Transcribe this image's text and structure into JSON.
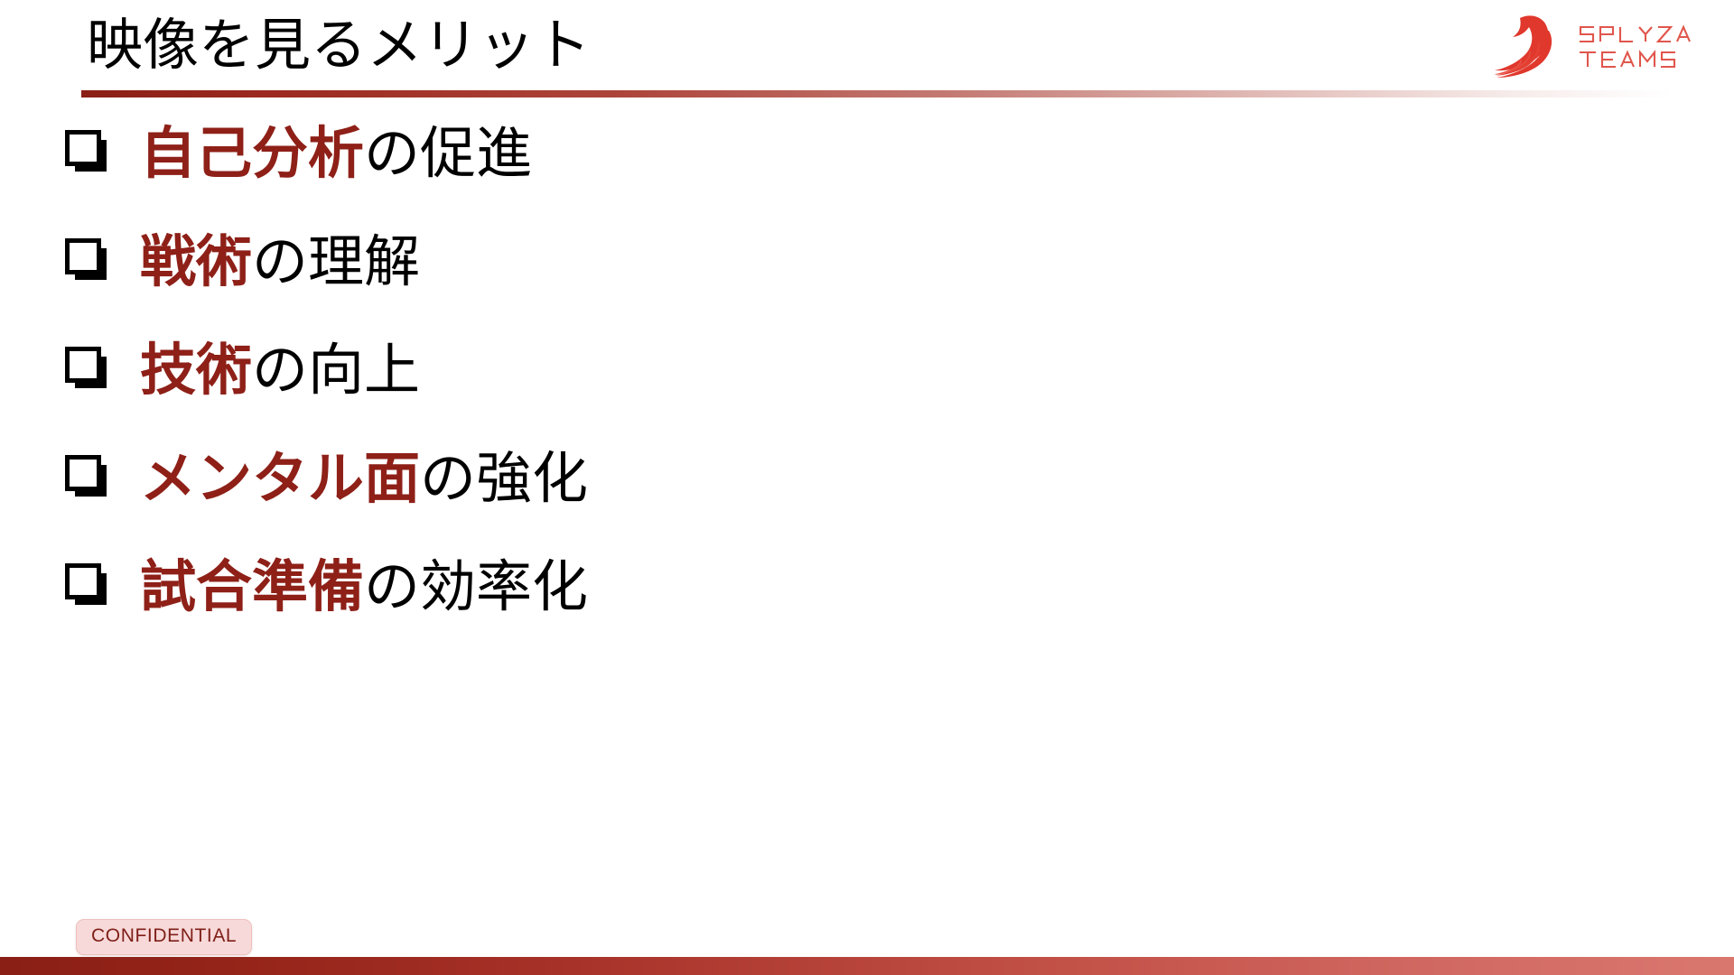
{
  "slide": {
    "title": "映像を見るメリット",
    "background_color": "#ffffff",
    "accent_color": "#8e2018",
    "footer_gradient_from": "#8a1f16",
    "footer_gradient_to": "#d9776f"
  },
  "logo": {
    "name": "splyza-teams-logo",
    "line1": "SPLYZA",
    "line2": "TEAMS",
    "color": "#e0382c"
  },
  "bullets": [
    {
      "marker": "shadowed-square-bullet",
      "accent": "自己分析",
      "plain": "の促進"
    },
    {
      "marker": "shadowed-square-bullet",
      "accent": "戦術",
      "plain": "の理解"
    },
    {
      "marker": "shadowed-square-bullet",
      "accent": "技術",
      "plain": "の向上"
    },
    {
      "marker": "shadowed-square-bullet",
      "accent": "メンタル面",
      "plain": "の強化"
    },
    {
      "marker": "shadowed-square-bullet",
      "accent": "試合準備",
      "plain": "の効率化"
    }
  ],
  "badge": {
    "label": "CONFIDENTIAL",
    "fill": "#f8d9d9",
    "text_color": "#7e1f18"
  }
}
